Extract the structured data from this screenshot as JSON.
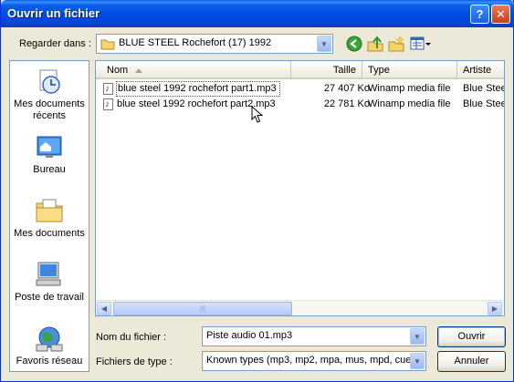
{
  "window": {
    "title": "Ouvrir un fichier",
    "help_glyph": "?",
    "close_glyph": "✕"
  },
  "lookin": {
    "label": "Regarder dans :",
    "value": "BLUE STEEL Rochefort (17) 1992"
  },
  "toolbar": {
    "icons": [
      "back-icon",
      "up-folder-icon",
      "new-folder-icon",
      "views-menu-icon"
    ]
  },
  "places": [
    {
      "label": "Mes documents récents",
      "icon": "recent-documents-icon"
    },
    {
      "label": "Bureau",
      "icon": "desktop-icon"
    },
    {
      "label": "Mes documents",
      "icon": "my-documents-icon"
    },
    {
      "label": "Poste de travail",
      "icon": "my-computer-icon"
    },
    {
      "label": "Favoris réseau",
      "icon": "network-places-icon"
    }
  ],
  "columns": {
    "name": "Nom",
    "size": "Taille",
    "type": "Type",
    "artist": "Artiste"
  },
  "files": [
    {
      "name": "blue steel 1992 rochefort part1.mp3",
      "size": "27 407 Ko",
      "type": "Winamp media file",
      "artist": "Blue Stee"
    },
    {
      "name": "blue steel 1992 rochefort part2.mp3",
      "size": "22 781 Ko",
      "type": "Winamp media file",
      "artist": "Blue Stee"
    }
  ],
  "filename": {
    "label": "Nom du fichier :",
    "value": "Piste audio 01.mp3"
  },
  "filetype": {
    "label": "Fichiers de type :",
    "value": "Known types (mp3, mp2, mpa, mus, mpd, cue)"
  },
  "buttons": {
    "open": "Ouvrir",
    "cancel": "Annuler"
  },
  "colors": {
    "title_bar": "#0A5FE8",
    "dialog_bg": "#ECE9D8",
    "field_border": "#7F9DB9"
  }
}
